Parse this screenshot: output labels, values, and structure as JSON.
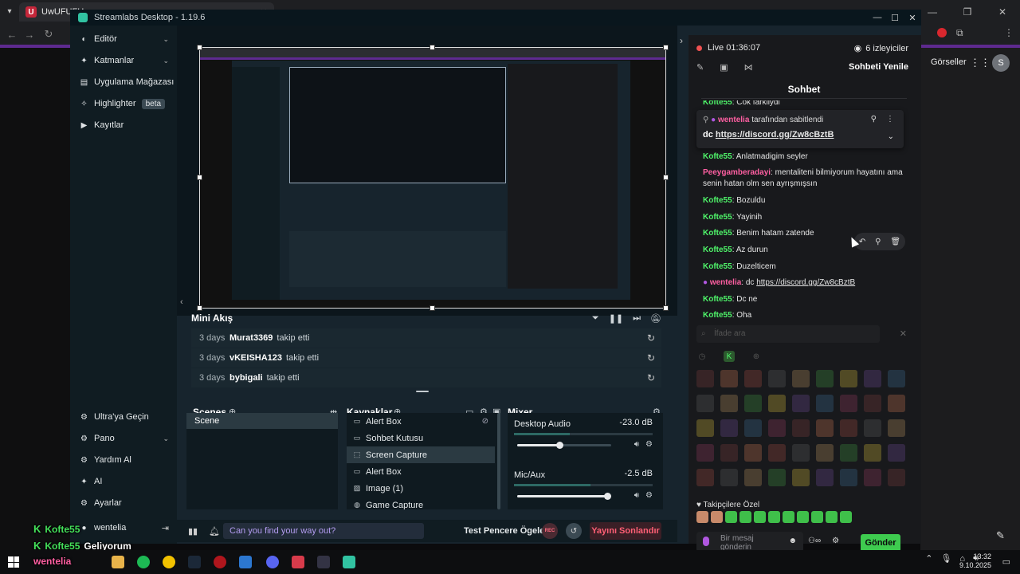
{
  "browser": {
    "tab_title": "UwUFUFU",
    "tab_favicon": "U",
    "right_link": "Görseller",
    "avatar_letter": "S"
  },
  "overlay": {
    "lines": [
      {
        "user": "Kofte55",
        "text": ""
      },
      {
        "user": "Kofte55",
        "text": "Geliyorum"
      },
      {
        "user": "wentelia",
        "text": ""
      }
    ]
  },
  "app": {
    "title": "Streamlabs Desktop - 1.19.6"
  },
  "sidebar": {
    "items": [
      {
        "label": "Editör",
        "icon": "editor-icon",
        "chevron": true
      },
      {
        "label": "Katmanlar",
        "icon": "layers-icon",
        "chevron": true
      },
      {
        "label": "Uygulama Mağazası",
        "icon": "store-icon",
        "chevron": false
      },
      {
        "label": "Highlighter",
        "icon": "highlighter-icon",
        "badge": "beta"
      },
      {
        "label": "Kayıtlar",
        "icon": "recordings-icon",
        "chevron": false
      }
    ],
    "bottom_items": [
      {
        "label": "Ultra'ya Geçin",
        "icon": "ultra-icon"
      },
      {
        "label": "Pano",
        "icon": "dashboard-icon",
        "chevron": true
      },
      {
        "label": "Yardım Al",
        "icon": "help-icon"
      },
      {
        "label": "AI",
        "icon": "ai-icon"
      },
      {
        "label": "Ayarlar",
        "icon": "settings-icon"
      }
    ],
    "user": "wentelia"
  },
  "mini_feed": {
    "title": "Mini Akış",
    "rows": [
      {
        "ago": "3 days",
        "user": "Murat3369",
        "action": "takip etti"
      },
      {
        "ago": "3 days",
        "user": "vKEISHA123",
        "action": "takip etti"
      },
      {
        "ago": "3 days",
        "user": "bybigali",
        "action": "takip etti"
      }
    ]
  },
  "scenes": {
    "title": "Scenes",
    "items": [
      "Scene"
    ]
  },
  "sources": {
    "title": "Kaynaklar",
    "items": [
      {
        "label": "Alert Box",
        "icon": "alert-box-icon"
      },
      {
        "label": "Sohbet Kutusu",
        "icon": "chat-box-icon"
      },
      {
        "label": "Screen Capture",
        "icon": "screen-capture-icon",
        "selected": true
      },
      {
        "label": "Alert Box",
        "icon": "alert-box-icon"
      },
      {
        "label": "Image (1)",
        "icon": "image-icon"
      },
      {
        "label": "Game Capture",
        "icon": "game-capture-icon"
      }
    ]
  },
  "mixer": {
    "title": "Mixer",
    "channels": [
      {
        "name": "Desktop Audio",
        "db": "-23.0 dB",
        "volume": 0.45
      },
      {
        "name": "Mic/Aux",
        "db": "-2.5 dB",
        "volume": 0.96
      }
    ]
  },
  "footer": {
    "message": "Can you find your way out?",
    "test_label": "Test Pencere Ögeleri",
    "rec_label": "REC",
    "end_stream": "Yayını Sonlandır"
  },
  "right": {
    "live_label": "Live",
    "live_time": "01:36:07",
    "viewers": "6 izleyiciler",
    "refresh": "Sohbeti Yenile",
    "chat_title": "Sohbet",
    "pinned": {
      "by_user": "wentelia",
      "by_text": "tarafından sabitlendi",
      "text_prefix": "dc",
      "link": "https://discord.gg/Zw8cBztB"
    },
    "messages": [
      {
        "user": "Kofte55",
        "text": "Cok farkliydi",
        "color": "k"
      },
      {
        "user": "Kofte55",
        "text": "Anlatmadigim seyler",
        "color": "k"
      },
      {
        "user": "Peeygamberadayi",
        "text": "mentaliteni bilmiyorum hayatını ama senin hatan olm sen ayrışmışsın",
        "color": "p"
      },
      {
        "user": "Kofte55",
        "text": "Bozuldu",
        "color": "k"
      },
      {
        "user": "Kofte55",
        "text": "Yayinih",
        "color": "k"
      },
      {
        "user": "Kofte55",
        "text": "Benim hatam zatende",
        "color": "k"
      },
      {
        "user": "Kofte55",
        "text": "Az durun",
        "color": "k"
      },
      {
        "user": "Kofte55",
        "text": "Duzelticem",
        "color": "k"
      },
      {
        "user": "wentelia",
        "text": "dc",
        "link": "https://discord.gg/Zw8cBztB",
        "color": "w"
      },
      {
        "user": "Kofte55",
        "text": "Dc ne",
        "color": "k"
      },
      {
        "user": "Kofte55",
        "text": "Oha",
        "color": "k"
      }
    ],
    "emote_search_placeholder": "İfade ara",
    "follower_emotes_title": "Takipçilere Özel",
    "input_placeholder_line1": "Bir mesaj",
    "input_placeholder_line2": "gönderin",
    "send": "Gönder"
  },
  "taskbar": {
    "time": "13:32",
    "date": "9.10.2025"
  },
  "colors": {
    "app_bg": "#17242d",
    "sidebar_bg": "#101c22",
    "accent_teal": "#31c3a2",
    "chat_bg": "#18191c",
    "kick_green": "#4ff56a",
    "purple_strip": "#5e2a8f",
    "end_red": "#ff5f75"
  }
}
